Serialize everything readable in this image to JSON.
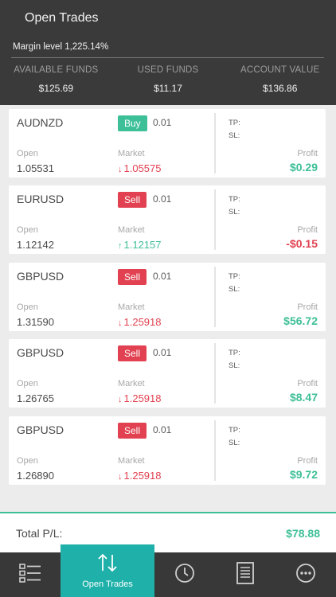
{
  "header": {
    "title": "Open Trades",
    "margin_level": "Margin level 1,225.14%",
    "funds": [
      {
        "label": "AVAILABLE FUNDS",
        "value": "$125.69"
      },
      {
        "label": "USED FUNDS",
        "value": "$11.17"
      },
      {
        "label": "ACCOUNT VALUE",
        "value": "$136.86"
      }
    ]
  },
  "trades": [
    {
      "symbol": "AUDNZD",
      "side": "Buy",
      "lot": "0.01",
      "open_label": "Open",
      "open": "1.05531",
      "market_label": "Market",
      "market": "1.05575",
      "direction": "down",
      "arrow": "↓",
      "tp_label": "TP:",
      "sl_label": "SL:",
      "profit_label": "Profit",
      "profit": "$0.29",
      "profit_sign": "pos"
    },
    {
      "symbol": "EURUSD",
      "side": "Sell",
      "lot": "0.01",
      "open_label": "Open",
      "open": "1.12142",
      "market_label": "Market",
      "market": "1.12157",
      "direction": "up",
      "arrow": "↑",
      "tp_label": "TP:",
      "sl_label": "SL:",
      "profit_label": "Profit",
      "profit": "-$0.15",
      "profit_sign": "neg"
    },
    {
      "symbol": "GBPUSD",
      "side": "Sell",
      "lot": "0.01",
      "open_label": "Open",
      "open": "1.31590",
      "market_label": "Market",
      "market": "1.25918",
      "direction": "down",
      "arrow": "↓",
      "tp_label": "TP:",
      "sl_label": "SL:",
      "profit_label": "Profit",
      "profit": "$56.72",
      "profit_sign": "pos"
    },
    {
      "symbol": "GBPUSD",
      "side": "Sell",
      "lot": "0.01",
      "open_label": "Open",
      "open": "1.26765",
      "market_label": "Market",
      "market": "1.25918",
      "direction": "down",
      "arrow": "↓",
      "tp_label": "TP:",
      "sl_label": "SL:",
      "profit_label": "Profit",
      "profit": "$8.47",
      "profit_sign": "pos"
    },
    {
      "symbol": "GBPUSD",
      "side": "Sell",
      "lot": "0.01",
      "open_label": "Open",
      "open": "1.26890",
      "market_label": "Market",
      "market": "1.25918",
      "direction": "down",
      "arrow": "↓",
      "tp_label": "TP:",
      "sl_label": "SL:",
      "profit_label": "Profit",
      "profit": "$9.72",
      "profit_sign": "pos"
    }
  ],
  "total": {
    "label": "Total P/L:",
    "value": "$78.88"
  },
  "tabbar": {
    "items": [
      {
        "icon": "list-icon"
      },
      {
        "icon": "transfer-arrows-icon",
        "label": "Open Trades",
        "active": true
      },
      {
        "icon": "clock-icon"
      },
      {
        "icon": "document-icon"
      },
      {
        "icon": "more-icon"
      }
    ]
  },
  "colors": {
    "accent": "#1fb1a9",
    "positive": "#3dbf97",
    "negative": "#e14150",
    "header_bg": "#3a3a3a"
  }
}
